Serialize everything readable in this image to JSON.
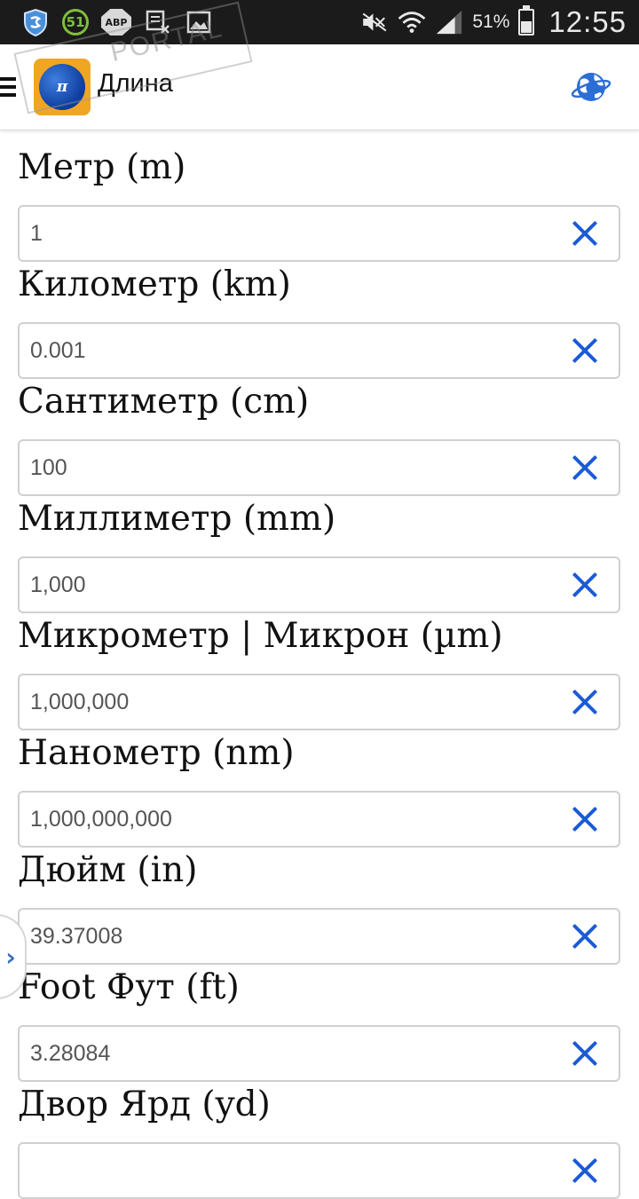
{
  "status_bar": {
    "notification_count": "51",
    "adblock_label": "ABP",
    "battery_percent": "51%",
    "battery_level": 0.51,
    "time": "12:55",
    "icons": [
      "shield-icon",
      "adblock-icon",
      "screenshot-icon",
      "gallery-icon",
      "mute-icon",
      "wifi-icon",
      "signal-icon",
      "battery-icon"
    ]
  },
  "app_bar": {
    "title": "Длина",
    "logo_text": "π",
    "icons": [
      "menu-icon",
      "globe-icon"
    ]
  },
  "watermark": {
    "text": "PORTAL"
  },
  "units": [
    {
      "label": "Метр (m)",
      "value": "1"
    },
    {
      "label": "Километр (km)",
      "value": "0.001"
    },
    {
      "label": "Сантиметр (cm)",
      "value": "100"
    },
    {
      "label": "Миллиметр (mm)",
      "value": "1,000"
    },
    {
      "label": "Микрометр | Микрон (µm)",
      "value": "1,000,000"
    },
    {
      "label": "Нанометр (nm)",
      "value": "1,000,000,000"
    },
    {
      "label": "Дюйм (in)",
      "value": "39.37008"
    },
    {
      "label": "Foot Фут (ft)",
      "value": "3.28084"
    },
    {
      "label": "Двор Ярд (yd)",
      "value": ""
    }
  ],
  "drawer_handle": {
    "glyph": "›"
  },
  "colors": {
    "accent": "#1a5bd6",
    "status_bar": "#1b1b1b",
    "logo_bg": "#f0a623"
  }
}
